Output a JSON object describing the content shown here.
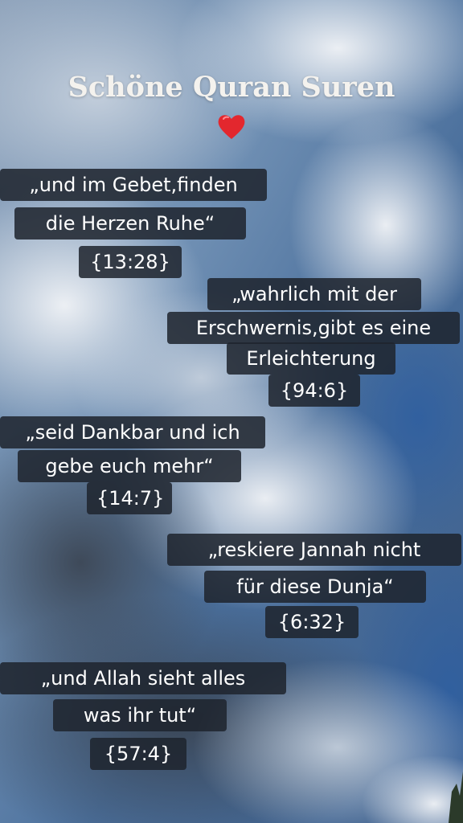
{
  "title": "Schöne Quran Suren",
  "heart": "❤️",
  "quotes": [
    {
      "lines": [
        "„und im Gebet,finden",
        "die Herzen Ruhe“"
      ],
      "ref": "{13:28}"
    },
    {
      "lines": [
        "„wahrlich mit der",
        "Erschwernis,gibt es eine",
        "Erleichterung"
      ],
      "ref": "{94:6}"
    },
    {
      "lines": [
        "„seid Dankbar und ich",
        "gebe euch mehr“"
      ],
      "ref": "{14:7}"
    },
    {
      "lines": [
        "„reskiere Jannah nicht",
        "für diese Dunja“"
      ],
      "ref": "{6:32}"
    },
    {
      "lines": [
        "„und Allah sieht alles",
        "was ihr tut“"
      ],
      "ref": "{57:4}"
    }
  ]
}
